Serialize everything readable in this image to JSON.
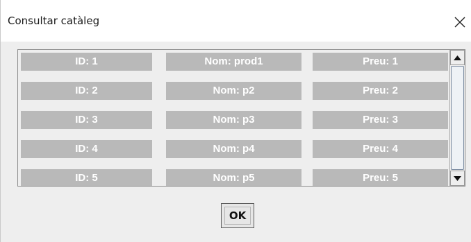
{
  "dialog": {
    "title": "Consultar catàleg",
    "close_icon": "close-icon",
    "ok_label": "OK"
  },
  "catalog": {
    "rows": [
      {
        "id": "ID: 1",
        "name": "Nom: prod1",
        "price": "Preu: 1"
      },
      {
        "id": "ID: 2",
        "name": "Nom: p2",
        "price": "Preu: 2"
      },
      {
        "id": "ID: 3",
        "name": "Nom: p3",
        "price": "Preu: 3"
      },
      {
        "id": "ID: 4",
        "name": "Nom: p4",
        "price": "Preu: 4"
      },
      {
        "id": "ID: 5",
        "name": "Nom: p5",
        "price": "Preu: 5"
      }
    ]
  },
  "scrollbar": {
    "up_icon": "scroll-up-arrow-icon",
    "down_icon": "scroll-down-arrow-icon"
  }
}
